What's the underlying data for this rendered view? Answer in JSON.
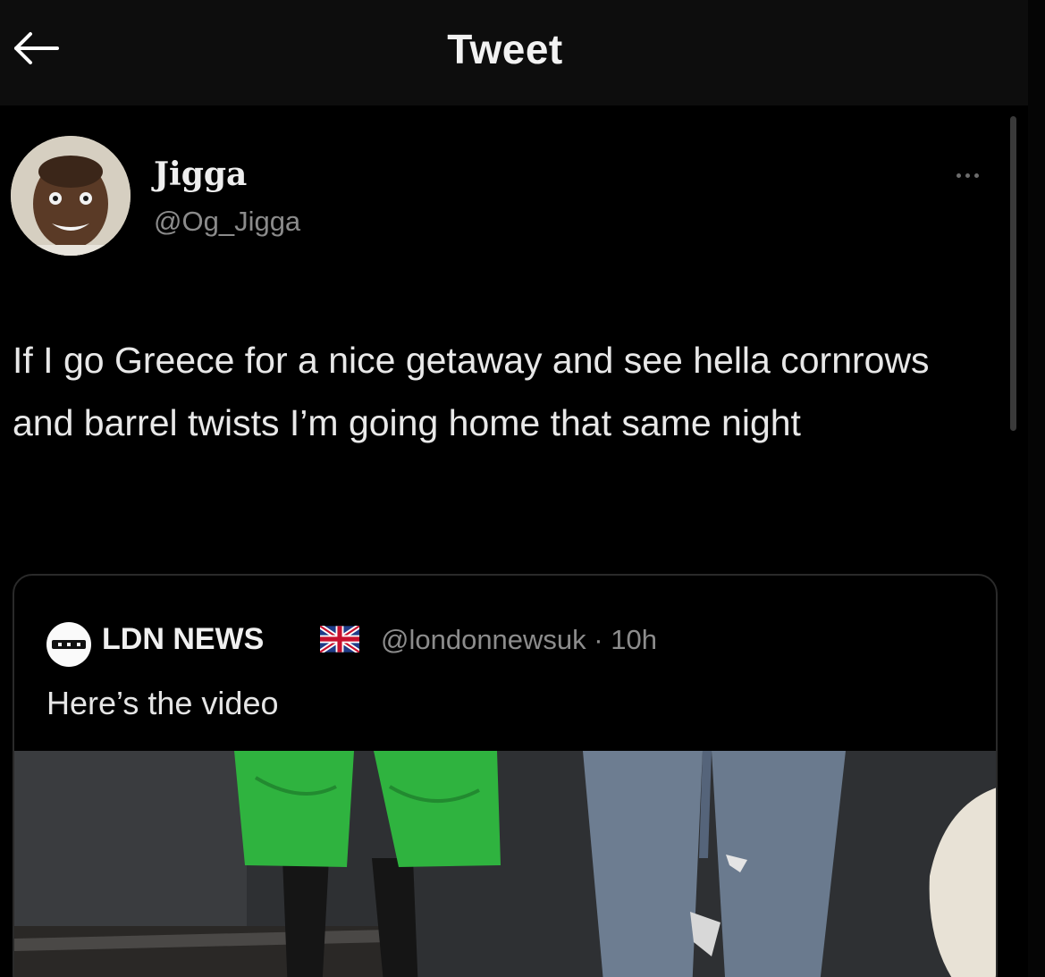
{
  "header": {
    "title": "Tweet",
    "back_icon": "arrow-left-icon"
  },
  "tweet": {
    "author_name": "Jigga",
    "author_handle": "@Og_Jigga",
    "more_icon": "more-horizontal-icon",
    "text": "If I go Greece for a nice getaway and see hella cornrows and barrel twists I’m going home that same night"
  },
  "quote": {
    "name": "LDN NEWS",
    "flag_icon": "uk-flag-icon",
    "handle": "@londonnewsuk",
    "separator": "·",
    "time": "10h",
    "text": "Here’s the video"
  },
  "colors": {
    "background": "#000000",
    "header_bg": "#0d0d0d",
    "text_primary": "#e7e9ea",
    "text_secondary": "#8b8b8b",
    "border": "#2a2a2a",
    "shorts_green": "#2fb33f",
    "jeans_blue": "#6d7d91"
  }
}
